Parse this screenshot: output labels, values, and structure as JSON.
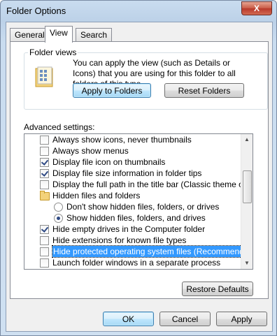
{
  "window": {
    "title": "Folder Options",
    "close_label": "X"
  },
  "tabs": [
    {
      "label": "General"
    },
    {
      "label": "View"
    },
    {
      "label": "Search"
    }
  ],
  "folder_views": {
    "title": "Folder views",
    "description": "You can apply the view (such as Details or Icons) that you are using for this folder to all folders of this type.",
    "apply_label": "Apply to Folders",
    "reset_label": "Reset Folders"
  },
  "advanced": {
    "label": "Advanced settings:",
    "items": [
      {
        "kind": "checkbox",
        "label": "Always show icons, never thumbnails",
        "checked": false
      },
      {
        "kind": "checkbox",
        "label": "Always show menus",
        "checked": false
      },
      {
        "kind": "checkbox",
        "label": "Display file icon on thumbnails",
        "checked": true
      },
      {
        "kind": "checkbox",
        "label": "Display file size information in folder tips",
        "checked": true
      },
      {
        "kind": "checkbox",
        "label": "Display the full path in the title bar (Classic theme only)",
        "checked": false
      },
      {
        "kind": "folder",
        "label": "Hidden files and folders"
      },
      {
        "kind": "radio",
        "label": "Don't show hidden files, folders, or drives",
        "checked": false
      },
      {
        "kind": "radio",
        "label": "Show hidden files, folders, and drives",
        "checked": true
      },
      {
        "kind": "checkbox",
        "label": "Hide empty drives in the Computer folder",
        "checked": true
      },
      {
        "kind": "checkbox",
        "label": "Hide extensions for known file types",
        "checked": false
      },
      {
        "kind": "checkbox",
        "label": "Hide protected operating system files (Recommended)",
        "checked": false,
        "selected": true
      },
      {
        "kind": "checkbox",
        "label": "Launch folder windows in a separate process",
        "checked": false
      }
    ]
  },
  "buttons": {
    "restore_defaults": "Restore Defaults",
    "ok": "OK",
    "cancel": "Cancel",
    "apply": "Apply"
  }
}
